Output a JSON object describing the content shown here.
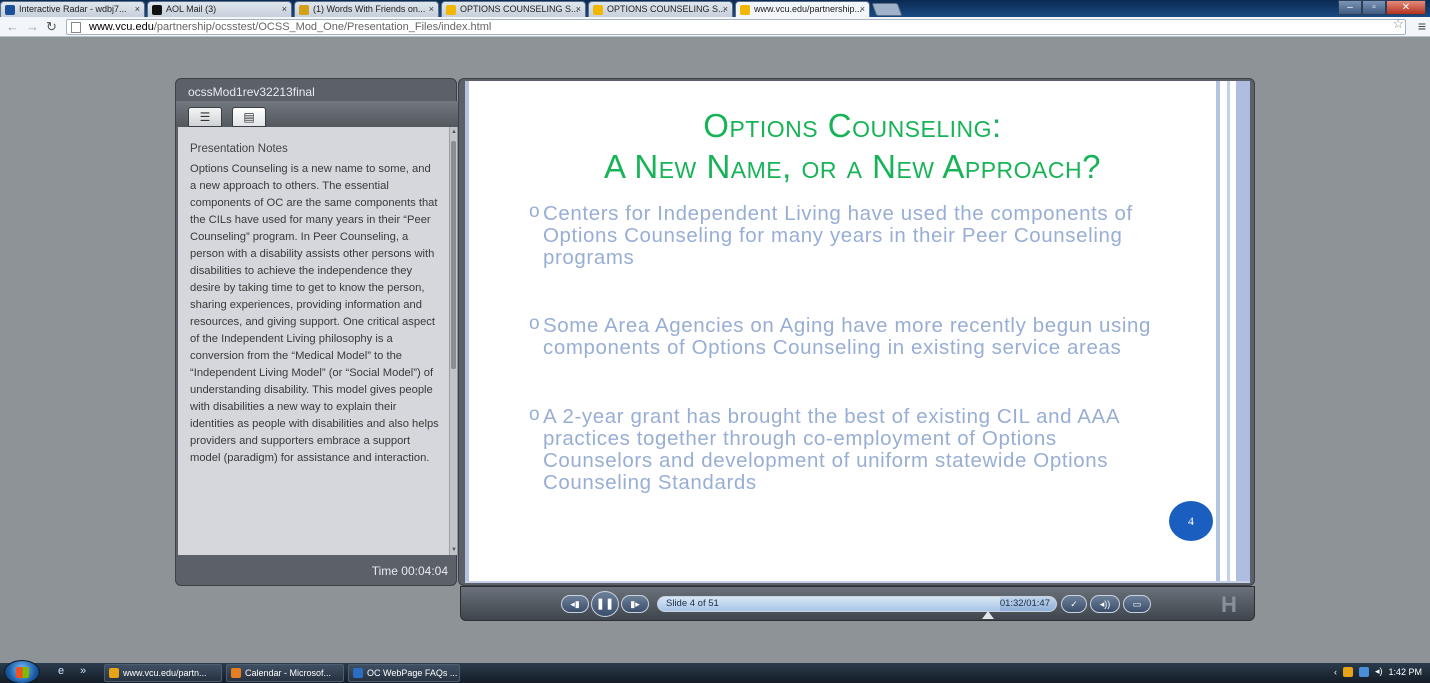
{
  "browser": {
    "tabs": [
      {
        "title": "Interactive Radar - wdbj7...",
        "favicon": "station-7-icon",
        "color": "#1b4f9a"
      },
      {
        "title": "AOL Mail (3)",
        "favicon": "aol-icon",
        "color": "#111111"
      },
      {
        "title": "(1) Words With Friends on...",
        "favicon": "words-with-friends-icon",
        "color": "#d4a017"
      },
      {
        "title": "OPTIONS COUNSELING S...",
        "favicon": "vcu-icon",
        "color": "#f2b700"
      },
      {
        "title": "OPTIONS COUNSELING S...",
        "favicon": "vcu-icon",
        "color": "#f2b700"
      },
      {
        "title": "www.vcu.edu/partnership...",
        "favicon": "vcu-icon",
        "color": "#f2b700"
      }
    ],
    "url_host": "www.vcu.edu",
    "url_path": "/partnership/ocsstest/OCSS_Mod_One/Presentation_Files/index.html"
  },
  "player": {
    "title": "ocssMod1rev32213final",
    "notes_heading": "Presentation Notes",
    "notes_text": "Options Counseling is a new name to some, and a new approach to others. The essential components of OC are the same components that the CILs have used for many years in their “Peer Counseling” program.  In Peer Counseling, a person with a disability assists other persons with disabilities to achieve the independence they desire by taking time to get to know the person, sharing experiences, providing information and resources, and giving support.  One critical aspect of the Independent Living philosophy is a conversion from the “Medical Model” to the “Independent Living Model” (or “Social Model”) of understanding disability.  This model gives people with disabilities a new way to explain their identities as people with disabilities and also helps providers and supporters embrace a support model (paradigm) for assistance and interaction.",
    "time_label": "Time 00:04:04",
    "slide": {
      "title_line1": "Options Counseling:",
      "title_line2": "A New Name, or a New Approach?",
      "bullets": [
        "Centers for Independent Living have used the components of Options Counseling for many years in their Peer Counseling programs",
        "Some Area Agencies on Aging have more recently begun using components of Options Counseling in existing service areas",
        "A 2-year grant has brought the best of existing CIL and AAA practices together through co-employment of Options Counselors and development of uniform statewide Options Counseling Standards"
      ],
      "number": "4"
    },
    "controls": {
      "slide_label": "Slide 4 of 51",
      "elapsed": "01:32",
      "duration": "01:47",
      "time_readout": "01:32/01:47",
      "progress": 0.86
    }
  },
  "taskbar": {
    "items": [
      {
        "label": "www.vcu.edu/partn...",
        "icon": "chrome-icon",
        "color": "#e8a317"
      },
      {
        "label": "Calendar - Microsof...",
        "icon": "outlook-icon",
        "color": "#e67e22"
      },
      {
        "label": "OC WebPage FAQs ...",
        "icon": "word-icon",
        "color": "#2b6cc4"
      }
    ],
    "clock": "1:42 PM"
  }
}
